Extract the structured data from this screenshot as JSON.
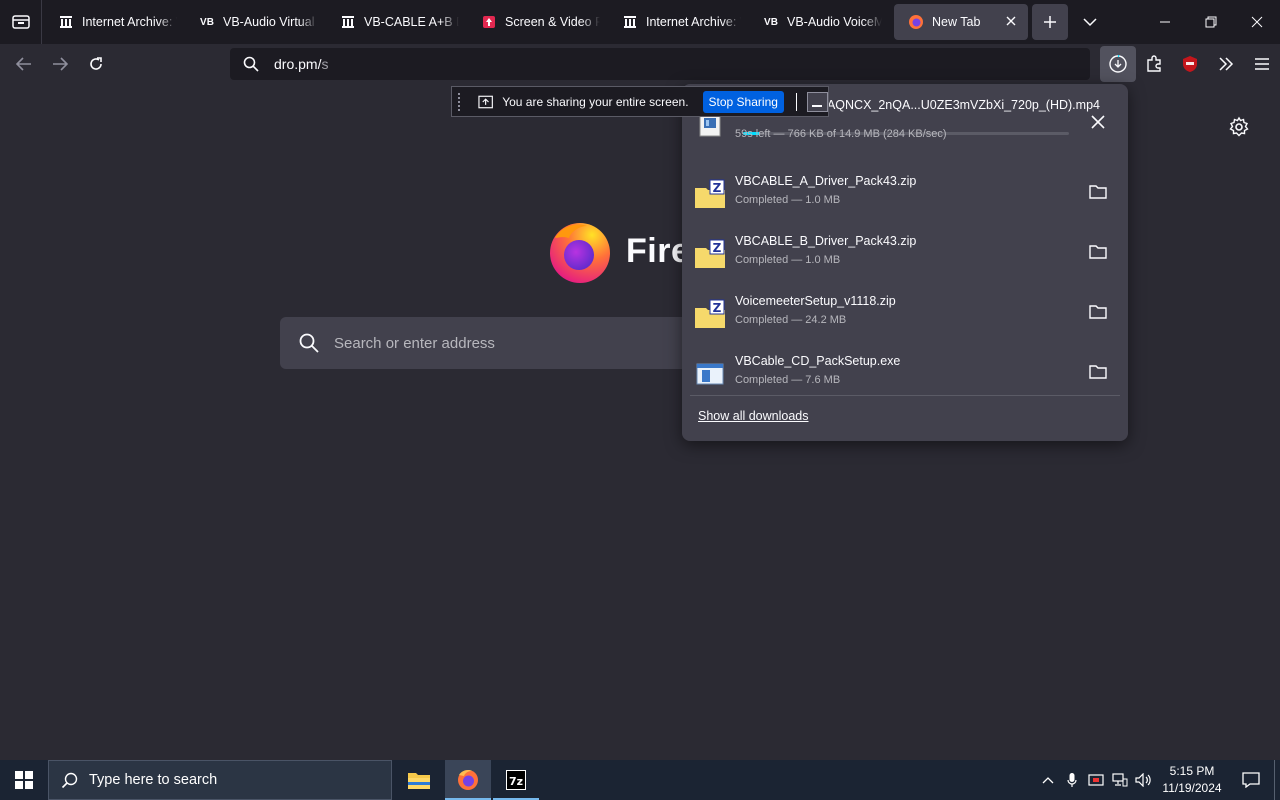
{
  "tabs": [
    {
      "label": "Internet Archive: Wayb",
      "icon": "archive-icon"
    },
    {
      "label": "VB-Audio Virtual Apps",
      "icon": "vb-icon"
    },
    {
      "label": "VB-CABLE A+B Driver",
      "icon": "archive-icon"
    },
    {
      "label": "Screen & Video Recor",
      "icon": "screen-recorder-icon"
    },
    {
      "label": "Internet Archive: Wayb",
      "icon": "archive-icon"
    },
    {
      "label": "VB-Audio VoiceMeeter",
      "icon": "vb-icon"
    },
    {
      "label": "New Tab",
      "icon": "firefox-icon",
      "active": true
    }
  ],
  "vb_favicon_text": "VB",
  "urlbar": {
    "text": "dro.pm/",
    "dim_text": "s"
  },
  "newtab": {
    "brand": "Firefox",
    "search_placeholder": "Search or enter address"
  },
  "share_bar": {
    "message": "You are sharing your entire screen.",
    "stop_label": "Stop Sharing"
  },
  "downloads": {
    "items": [
      {
        "name": "_AQNCX_2nQA...U0ZE3mVZbXi_720p_(HD).mp4",
        "status": "59s left — 766 KB of 14.9 MB (284 KB/sec)",
        "in_progress": true,
        "progress": 0.05
      },
      {
        "name": "VBCABLE_A_Driver_Pack43.zip",
        "status": "Completed — 1.0 MB",
        "type": "zip"
      },
      {
        "name": "VBCABLE_B_Driver_Pack43.zip",
        "status": "Completed — 1.0 MB",
        "type": "zip"
      },
      {
        "name": "VoicemeeterSetup_v1118.zip",
        "status": "Completed — 24.2 MB",
        "type": "zip"
      },
      {
        "name": "VBCable_CD_PackSetup.exe",
        "status": "Completed — 7.6 MB",
        "type": "exe"
      }
    ],
    "show_all_label": "Show all downloads"
  },
  "taskbar": {
    "search_placeholder": "Type here to search",
    "time": "5:15 PM",
    "date": "11/19/2024"
  },
  "colors": {
    "accent": "#0061e0",
    "progress": "#00ddff",
    "download_active": "#00ddff"
  }
}
